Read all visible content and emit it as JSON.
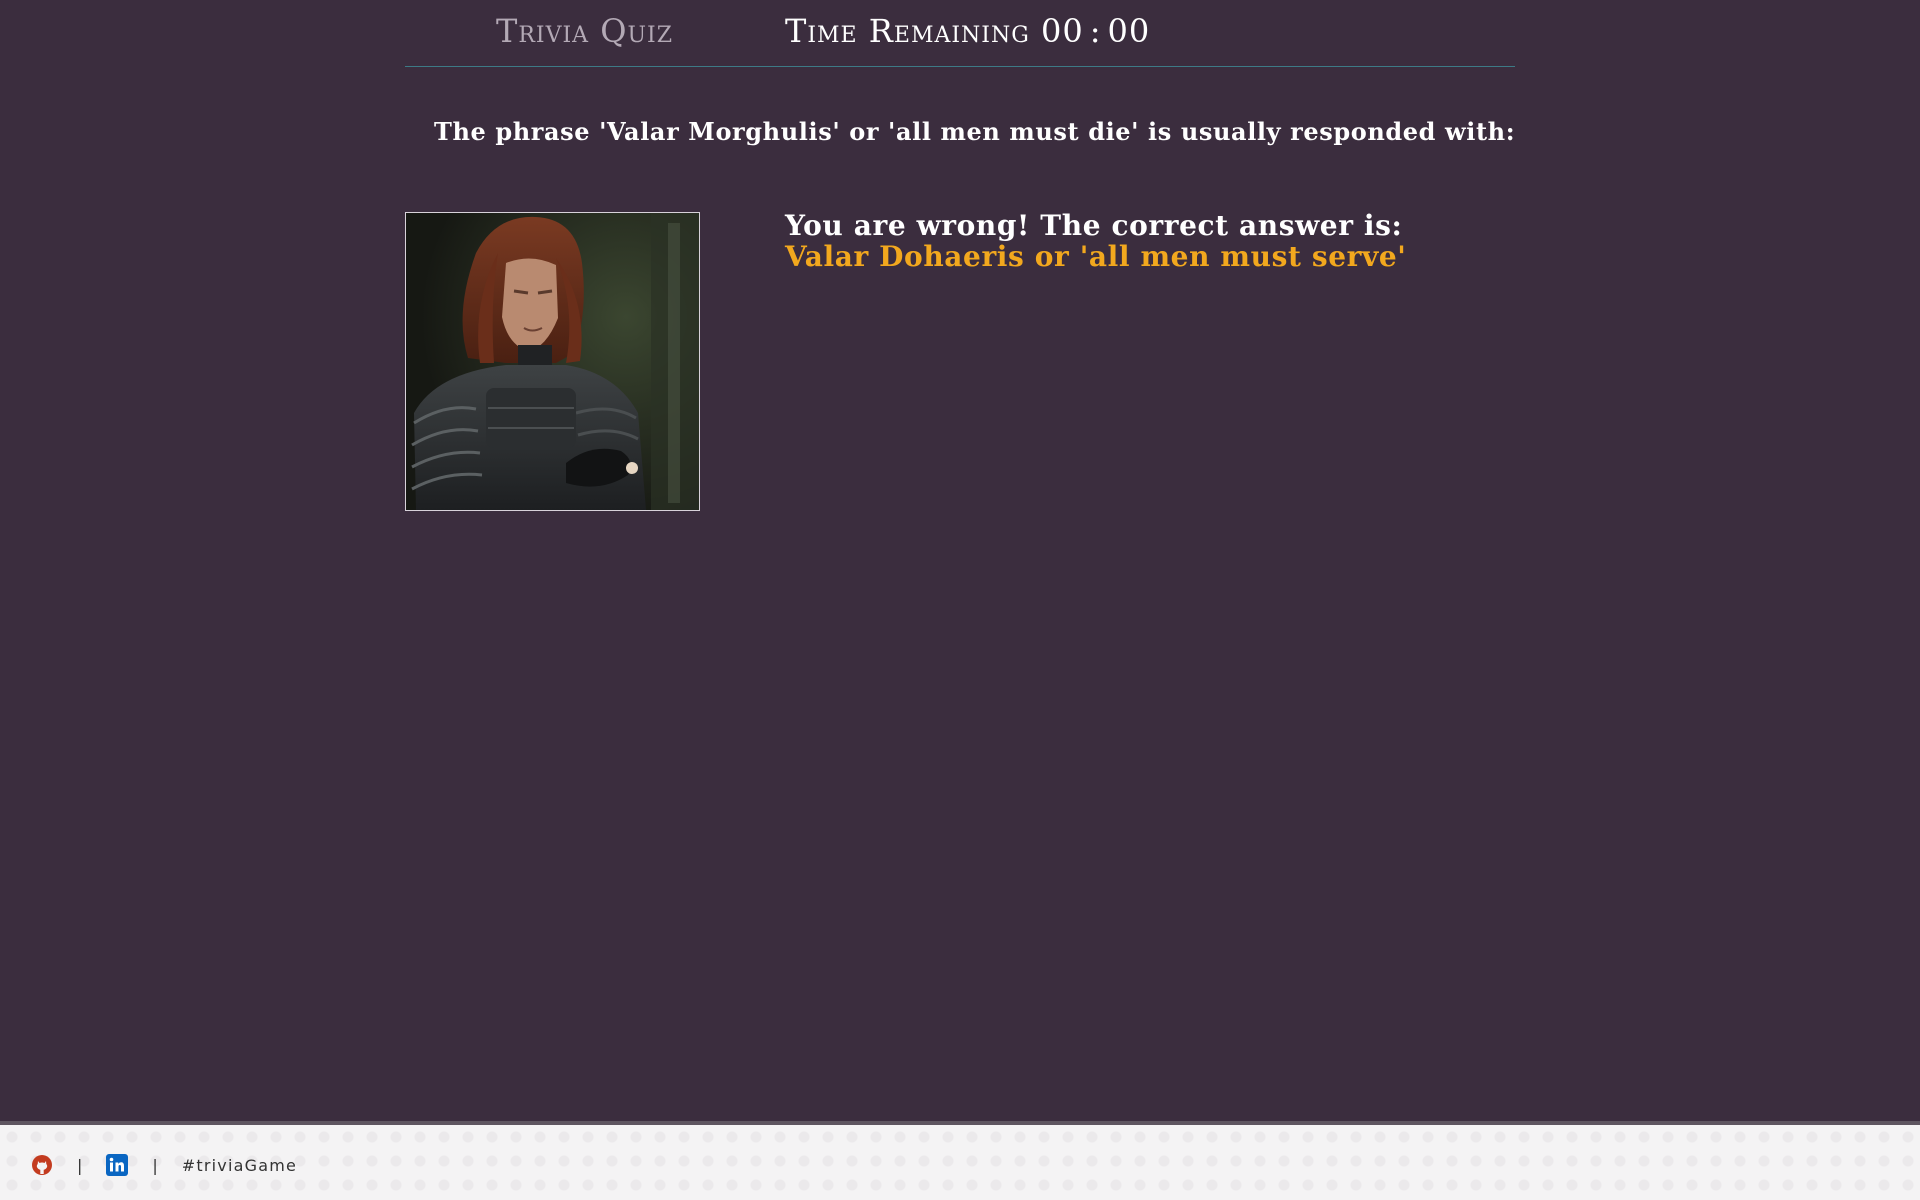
{
  "header": {
    "brand": "Trivia Quiz",
    "timer_label": "Time Remaining",
    "timer_minutes": "00",
    "timer_separator": ":",
    "timer_seconds": "00"
  },
  "question": {
    "text": "The phrase 'Valar Morghulis' or 'all men must die' is usually responded with:"
  },
  "result": {
    "message": "You are wrong! The correct answer is:",
    "correct_answer": "Valar Dohaeris or 'all men must serve'",
    "answer_color": "#f2a81e"
  },
  "footer": {
    "github_icon": "github-icon",
    "linkedin_icon": "linkedin-icon",
    "separator": "|",
    "hashtag": "#triviaGame"
  },
  "colors": {
    "background": "#3b2d3e",
    "header_rule": "#3d7a86",
    "footer_bg": "#f4f3f4"
  }
}
